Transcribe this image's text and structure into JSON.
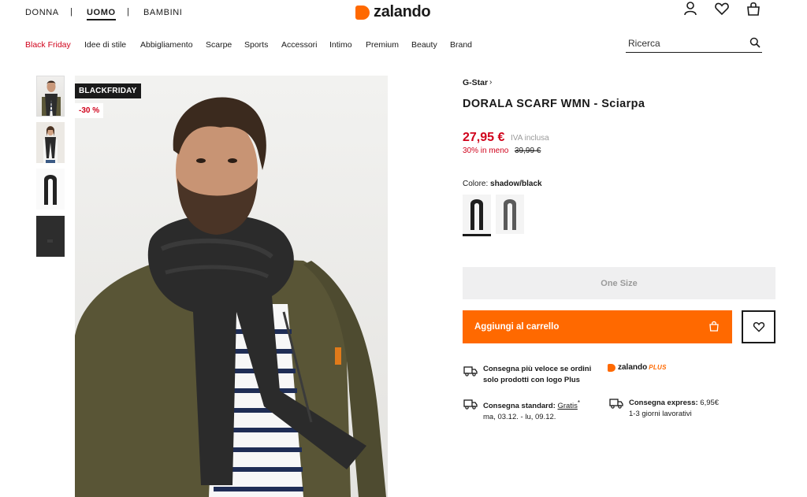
{
  "header": {
    "genders": [
      "DONNA",
      "UOMO",
      "BAMBINI"
    ],
    "active_gender": "UOMO",
    "logo_text": "zalando",
    "nav": [
      "Black Friday",
      "Idee di stile",
      "Abbigliamento",
      "Scarpe",
      "Sports",
      "Accessori",
      "Intimo",
      "Premium",
      "Beauty",
      "Brand"
    ],
    "search_placeholder": "Ricerca",
    "icons": [
      "user-icon",
      "heart-icon",
      "bag-icon",
      "search-icon"
    ]
  },
  "gallery": {
    "badge_promo": "BLACKFRIDAY",
    "badge_discount": "-30 %"
  },
  "product": {
    "brand": "G-Star",
    "title": "DORALA SCARF WMN - Sciarpa",
    "price": "27,95 €",
    "vat_note": "IVA inclusa",
    "discount_text": "30% in meno",
    "old_price": "39,99 €",
    "color_label": "Colore:",
    "color_value": "shadow/black",
    "size_label": "One Size",
    "add_to_cart": "Aggiungi al carrello"
  },
  "shipping": {
    "fast_line1": "Consegna più veloce se ordini",
    "fast_line2": "solo prodotti con logo Plus",
    "plus_logo_text": "zalando",
    "plus_logo_suffix": "PLUS",
    "standard_label": "Consegna standard:",
    "standard_price": "Gratis",
    "standard_mark": "*",
    "standard_dates": "ma, 03.12. - lu, 09.12.",
    "express_label": "Consegna express:",
    "express_price": "6,95€",
    "express_days": "1-3 giorni lavorativi"
  },
  "colors": {
    "accent": "#ff6900",
    "sale_red": "#d0021b",
    "text": "#1a1a1a"
  }
}
